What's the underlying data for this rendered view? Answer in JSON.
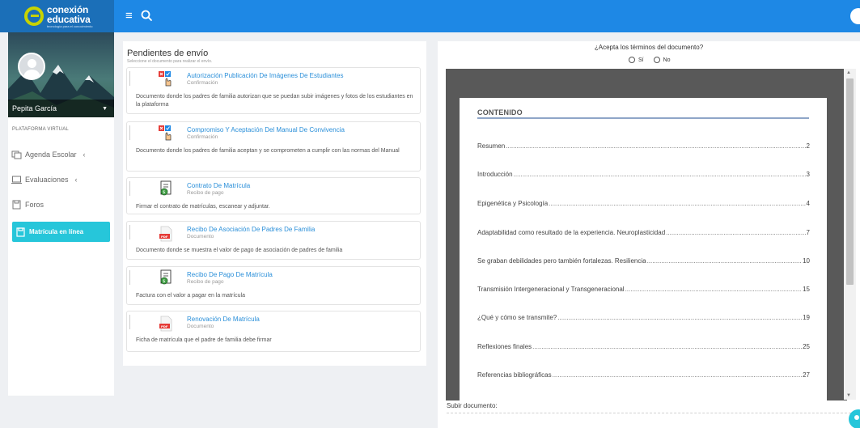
{
  "brand": {
    "name_line1": "conexión",
    "name_line2": "educativa",
    "tagline": "tecnología para el conocimiento"
  },
  "user": {
    "name": "Pepita García"
  },
  "sidebar": {
    "section_label": "PLATAFORMA VIRTUAL",
    "items": [
      {
        "label": "Agenda Escolar",
        "icon": "calendar-icon"
      },
      {
        "label": "Evaluaciones",
        "icon": "laptop-icon"
      },
      {
        "label": "Foros",
        "icon": "forum-icon"
      },
      {
        "label": "Matrícula en línea",
        "icon": "enrollment-icon",
        "active": true
      }
    ]
  },
  "pending": {
    "title": "Pendientes de envío",
    "subtitle": "Seleccione el documento para realizar el envío.",
    "cards": [
      {
        "title": "Autorización Publicación De Imágenes De Estudiantes",
        "type": "Confirmación",
        "icon": "confirm-icon",
        "description": "Documento donde los padres de familia autorizan que se puedan subir imágenes y fotos de los estudiantes en la plataforma"
      },
      {
        "title": "Compromiso Y Aceptación Del Manual De Convivencia",
        "type": "Confirmación",
        "icon": "confirm-icon",
        "description": "Documento donde los padres de familia aceptan y se comprometen a cumplir con las normas del Manual"
      },
      {
        "title": "Contrato De Matrícula",
        "type": "Recibo de pago",
        "icon": "receipt-icon",
        "description": "Firmar el contrato de matrículas, escanear y adjuntar."
      },
      {
        "title": "Recibo De Asociación De Padres De Familia",
        "type": "Documento",
        "icon": "pdf-icon",
        "description": "Documento donde se muestra el valor de pago de asociación de padres de familia"
      },
      {
        "title": "Recibo De Pago De Matrícula",
        "type": "Recibo de pago",
        "icon": "receipt-icon",
        "description": "Factura con el valor a pagar en la matrícula"
      },
      {
        "title": "Renovación De Matrícula",
        "type": "Documento",
        "icon": "pdf-icon",
        "description": "Ficha de matrícula que el padre de familia debe firmar"
      }
    ]
  },
  "terms": {
    "question": "¿Acepta los términos del documento?",
    "option_yes": "Sí",
    "option_no": "No"
  },
  "document": {
    "heading": "CONTENIDO",
    "toc": [
      {
        "title": "Resumen",
        "page": "2"
      },
      {
        "title": "Introducción",
        "page": "3"
      },
      {
        "title": "Epigenética y Psicología",
        "page": "4"
      },
      {
        "title": "Adaptabilidad como resultado de la experiencia. Neuroplasticidad",
        "page": "7"
      },
      {
        "title": "Se graban debilidades pero también fortalezas. Resiliencia",
        "page": "10"
      },
      {
        "title": "Transmisión Intergeneracional y Transgeneracional",
        "page": "15"
      },
      {
        "title": "¿Qué y cómo se transmite?",
        "page": "19"
      },
      {
        "title": "Reflexiones finales",
        "page": "25"
      },
      {
        "title": "Referencias bibliográficas",
        "page": "27"
      }
    ]
  },
  "upload": {
    "label": "Subir documento:"
  },
  "colors": {
    "topbar": "#1e88e5",
    "accent": "#26c6da",
    "link": "#2a8fd9"
  }
}
